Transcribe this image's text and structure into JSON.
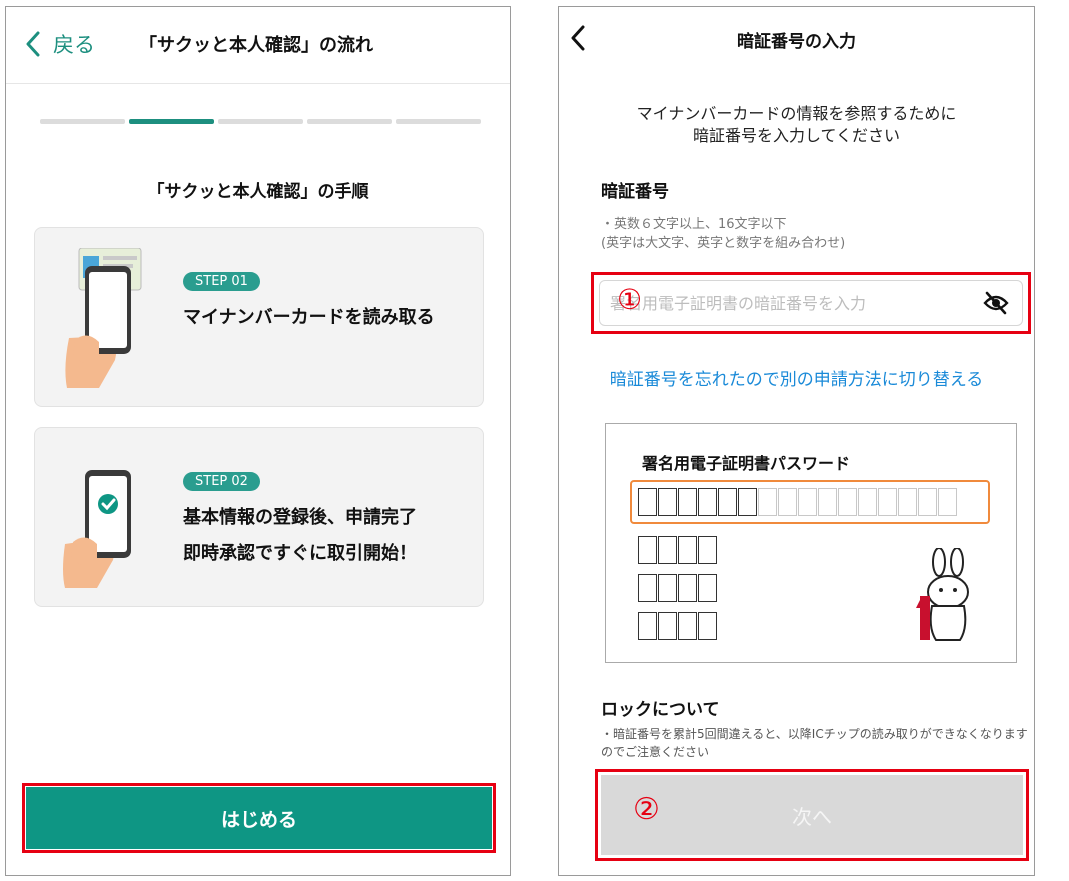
{
  "left": {
    "header": {
      "back_label": "戻る",
      "title": "「サクッと本人確認」の流れ"
    },
    "progress": {
      "total_steps": 5,
      "current_step": 2
    },
    "procedure_title": "「サクッと本人確認」の手順",
    "steps": [
      {
        "badge": "STEP 01",
        "lines": [
          "マイナンバーカードを読み取る"
        ],
        "icon": "phone-scanning-card-icon"
      },
      {
        "badge": "STEP 02",
        "lines": [
          "基本情報の登録後、申請完了",
          "即時承認ですぐに取引開始！"
        ],
        "icon": "phone-checkmark-icon"
      }
    ],
    "start_button": "はじめる",
    "colors": {
      "accent": "#0e9684",
      "highlight": "#e60012"
    }
  },
  "right": {
    "header": {
      "title": "暗証番号の入力"
    },
    "description": [
      "マイナンバーカードの情報を参照するために",
      "暗証番号を入力してください"
    ],
    "pin_label": "暗証番号",
    "pin_notes": [
      "・英数６文字以上、16文字以下",
      "(英字は大文字、英字と数字を組み合わせ)"
    ],
    "pin_placeholder": "署名用電子証明書の暗証番号を入力",
    "annotation_1": "①",
    "forgot_link": "暗証番号を忘れたので別の申請方法に切り替える",
    "password_card": {
      "title": "署名用電子証明書パスワード",
      "row_cells": 16,
      "row_cells_dark": 6,
      "small_rows": 3,
      "small_row_cells": 4
    },
    "lock_title": "ロックについて",
    "lock_note": "・暗証番号を累計5回間違えると、以降ICチップの読み取りができなくなりますのでご注意ください",
    "annotation_2": "②",
    "next_button": "次へ",
    "colors": {
      "link": "#1a8ad8",
      "highlight": "#e60012",
      "orange": "#f08a3c"
    }
  }
}
